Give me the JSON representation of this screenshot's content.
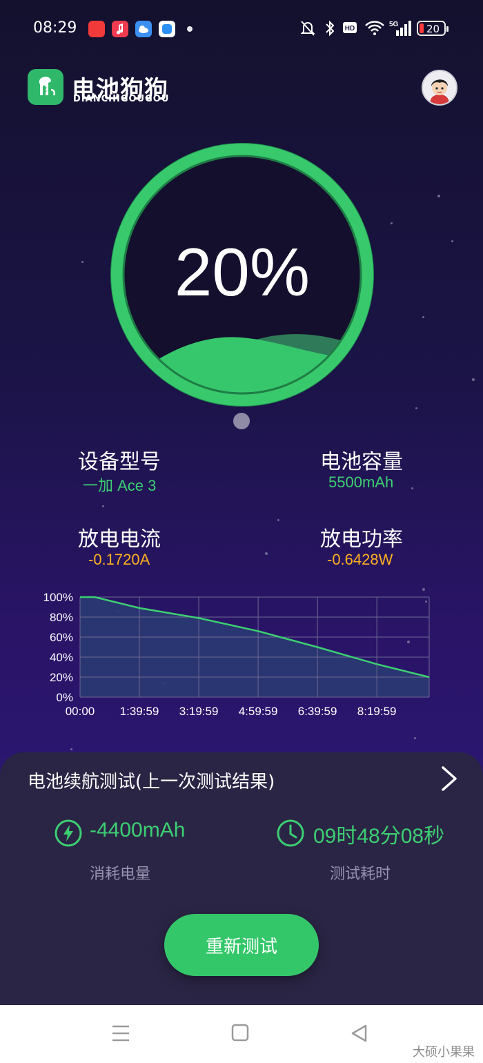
{
  "status_bar": {
    "time": "08:29",
    "battery_level": "20",
    "icons": [
      "red-app-icon",
      "music-app-icon",
      "weather-app-icon",
      "blue-app-icon",
      "dot-icon",
      "mute-bell-icon",
      "bluetooth-icon",
      "hd-icon",
      "wifi-icon",
      "5g-signal-icon",
      "battery-icon"
    ]
  },
  "header": {
    "app_name": "电池狗狗",
    "app_name_en": "DIANCHIGOUGOU",
    "logo_icon": "dog-logo-icon",
    "avatar_icon": "cartoon-avatar-icon"
  },
  "gauge": {
    "value": "20%",
    "level": 0.2,
    "color": "#34c76a"
  },
  "info": {
    "model_label": "设备型号",
    "model_value": "一加 Ace 3",
    "capacity_label": "电池容量",
    "capacity_value": "5500mAh",
    "current_label": "放电电流",
    "current_value": "-0.1720A",
    "power_label": "放电功率",
    "power_value": "-0.6428W"
  },
  "chart_data": {
    "type": "area",
    "title": "",
    "xlabel": "",
    "ylabel": "",
    "y_ticks": [
      "100%",
      "80%",
      "60%",
      "40%",
      "20%",
      "0%"
    ],
    "x_ticks": [
      "00:00",
      "1:39:59",
      "3:19:59",
      "4:59:59",
      "6:39:59",
      "8:19:59"
    ],
    "ylim": [
      0,
      100
    ],
    "x_seconds_range": [
      0,
      35288
    ],
    "series": [
      {
        "values": [
          {
            "t": 0,
            "v": 100
          },
          {
            "t": 1500,
            "v": 100
          },
          {
            "t": 5999,
            "v": 89
          },
          {
            "t": 11999,
            "v": 79
          },
          {
            "t": 17999,
            "v": 66
          },
          {
            "t": 23999,
            "v": 50
          },
          {
            "t": 29999,
            "v": 33
          },
          {
            "t": 35288,
            "v": 20
          }
        ]
      }
    ],
    "line_color": "#3ccf72",
    "fill_color": "#2a3a72",
    "grid": true
  },
  "card": {
    "title": "电池续航测试(上一次测试结果)",
    "chevron_icon": "chevron-right-icon",
    "consumed_value": "-4400mAh",
    "consumed_label": "消耗电量",
    "consumed_icon": "lightning-icon",
    "duration_value": "09时48分08秒",
    "duration_label": "测试耗时",
    "duration_icon": "clock-icon",
    "retest_label": "重新测试"
  },
  "nav": {
    "menu_icon": "menu-icon",
    "home_icon": "home-square-icon",
    "back_icon": "back-triangle-icon"
  },
  "watermark": "大硕小果果"
}
